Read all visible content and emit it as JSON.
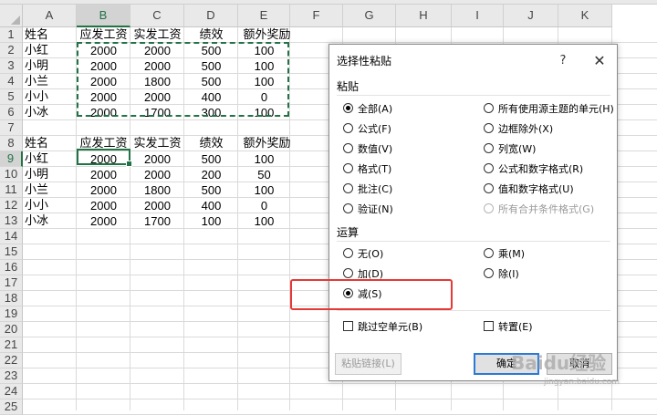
{
  "spreadsheet": {
    "columns": [
      "A",
      "B",
      "C",
      "D",
      "E",
      "F",
      "G",
      "H",
      "I",
      "J",
      "K"
    ],
    "rows": [
      "1",
      "2",
      "3",
      "4",
      "5",
      "6",
      "7",
      "8",
      "9",
      "10",
      "11",
      "12",
      "13",
      "14",
      "15",
      "16",
      "17",
      "18",
      "19",
      "20",
      "21",
      "22",
      "23",
      "24",
      "25"
    ],
    "table1": {
      "headers": [
        "姓名",
        "应发工资",
        "实发工资",
        "绩效",
        "额外奖励"
      ],
      "data": [
        [
          "小红",
          "2000",
          "2000",
          "500",
          "100"
        ],
        [
          "小明",
          "2000",
          "2000",
          "500",
          "100"
        ],
        [
          "小兰",
          "2000",
          "1800",
          "500",
          "100"
        ],
        [
          "小小",
          "2000",
          "2000",
          "400",
          "0"
        ],
        [
          "小冰",
          "2000",
          "1700",
          "300",
          "100"
        ]
      ]
    },
    "table2": {
      "headers": [
        "姓名",
        "应发工资",
        "实发工资",
        "绩效",
        "额外奖励"
      ],
      "data": [
        [
          "小红",
          "2000",
          "2000",
          "500",
          "100"
        ],
        [
          "小明",
          "2000",
          "2000",
          "200",
          "50"
        ],
        [
          "小兰",
          "2000",
          "1800",
          "500",
          "100"
        ],
        [
          "小小",
          "2000",
          "2000",
          "400",
          "0"
        ],
        [
          "小冰",
          "2000",
          "1700",
          "100",
          "100"
        ]
      ]
    }
  },
  "dialog": {
    "title": "选择性粘贴",
    "help": "?",
    "close": "✕",
    "paste_group": "粘贴",
    "paste_options_left": [
      {
        "label": "全部(A)",
        "checked": true
      },
      {
        "label": "公式(F)",
        "checked": false
      },
      {
        "label": "数值(V)",
        "checked": false
      },
      {
        "label": "格式(T)",
        "checked": false
      },
      {
        "label": "批注(C)",
        "checked": false
      },
      {
        "label": "验证(N)",
        "checked": false
      }
    ],
    "paste_options_right": [
      {
        "label": "所有使用源主题的单元(H)",
        "disabled": false
      },
      {
        "label": "边框除外(X)",
        "disabled": false
      },
      {
        "label": "列宽(W)",
        "disabled": false
      },
      {
        "label": "公式和数字格式(R)",
        "disabled": false
      },
      {
        "label": "值和数字格式(U)",
        "disabled": false
      },
      {
        "label": "所有合并条件格式(G)",
        "disabled": true
      }
    ],
    "operation_group": "运算",
    "operation_left": [
      {
        "label": "无(O)",
        "checked": false
      },
      {
        "label": "加(D)",
        "checked": false
      },
      {
        "label": "减(S)",
        "checked": true
      }
    ],
    "operation_right": [
      {
        "label": "乘(M)",
        "checked": false
      },
      {
        "label": "除(I)",
        "checked": false
      }
    ],
    "skip_blanks": "跳过空单元(B)",
    "transpose": "转置(E)",
    "paste_link": "粘贴链接(L)",
    "ok": "确定",
    "cancel": "取消"
  },
  "watermark": {
    "text": "Baidu经验",
    "url": "jingyan.baidu.com"
  },
  "colors": {
    "excel_green": "#217346",
    "highlight_red": "#e53935",
    "default_button_blue": "#2b79d8"
  }
}
